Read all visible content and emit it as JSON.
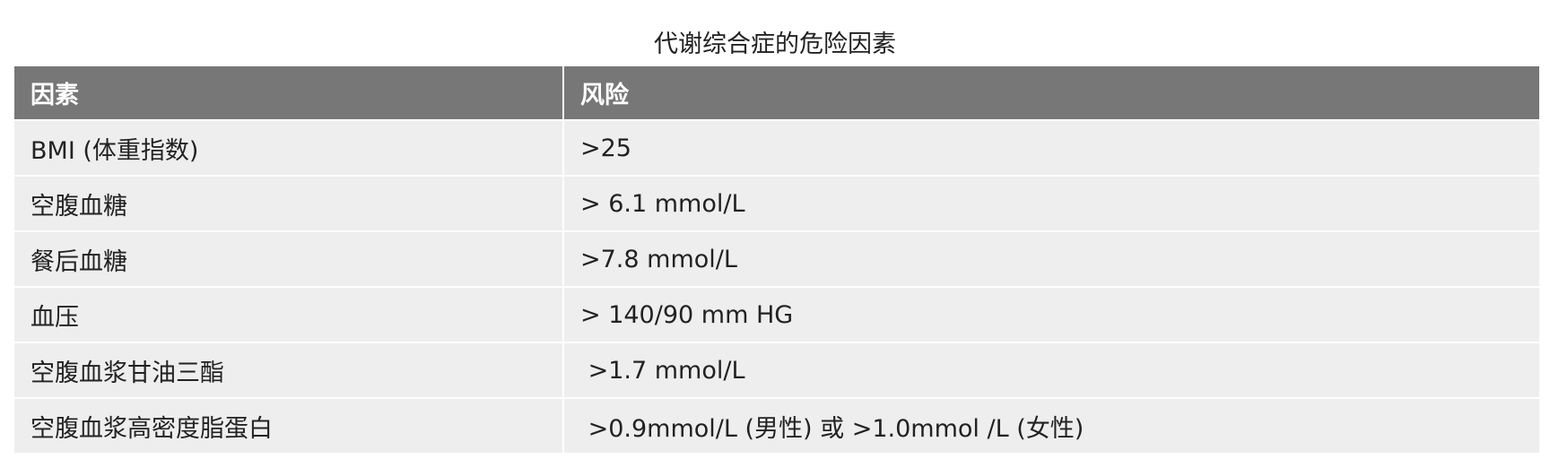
{
  "table": {
    "title": "代谢综合症的危险因素",
    "headers": [
      "因素",
      "风险"
    ],
    "rows": [
      [
        "BMI (体重指数)",
        ">25"
      ],
      [
        "空腹血糖",
        "> 6.1 mmol/L"
      ],
      [
        "餐后血糖",
        ">7.8 mmol/L"
      ],
      [
        "血压",
        "> 140/90 mm HG"
      ],
      [
        "空腹血浆甘油三酯",
        " >1.7 mmol/L"
      ],
      [
        "空腹血浆高密度脂蛋白",
        " >0.9mmol/L (男性) 或 >1.0mmol /L (女性)"
      ]
    ]
  },
  "colors": {
    "header_bg": "#777777",
    "header_text": "#ffffff",
    "row_bg": "#eeeeee",
    "text": "#222222"
  }
}
